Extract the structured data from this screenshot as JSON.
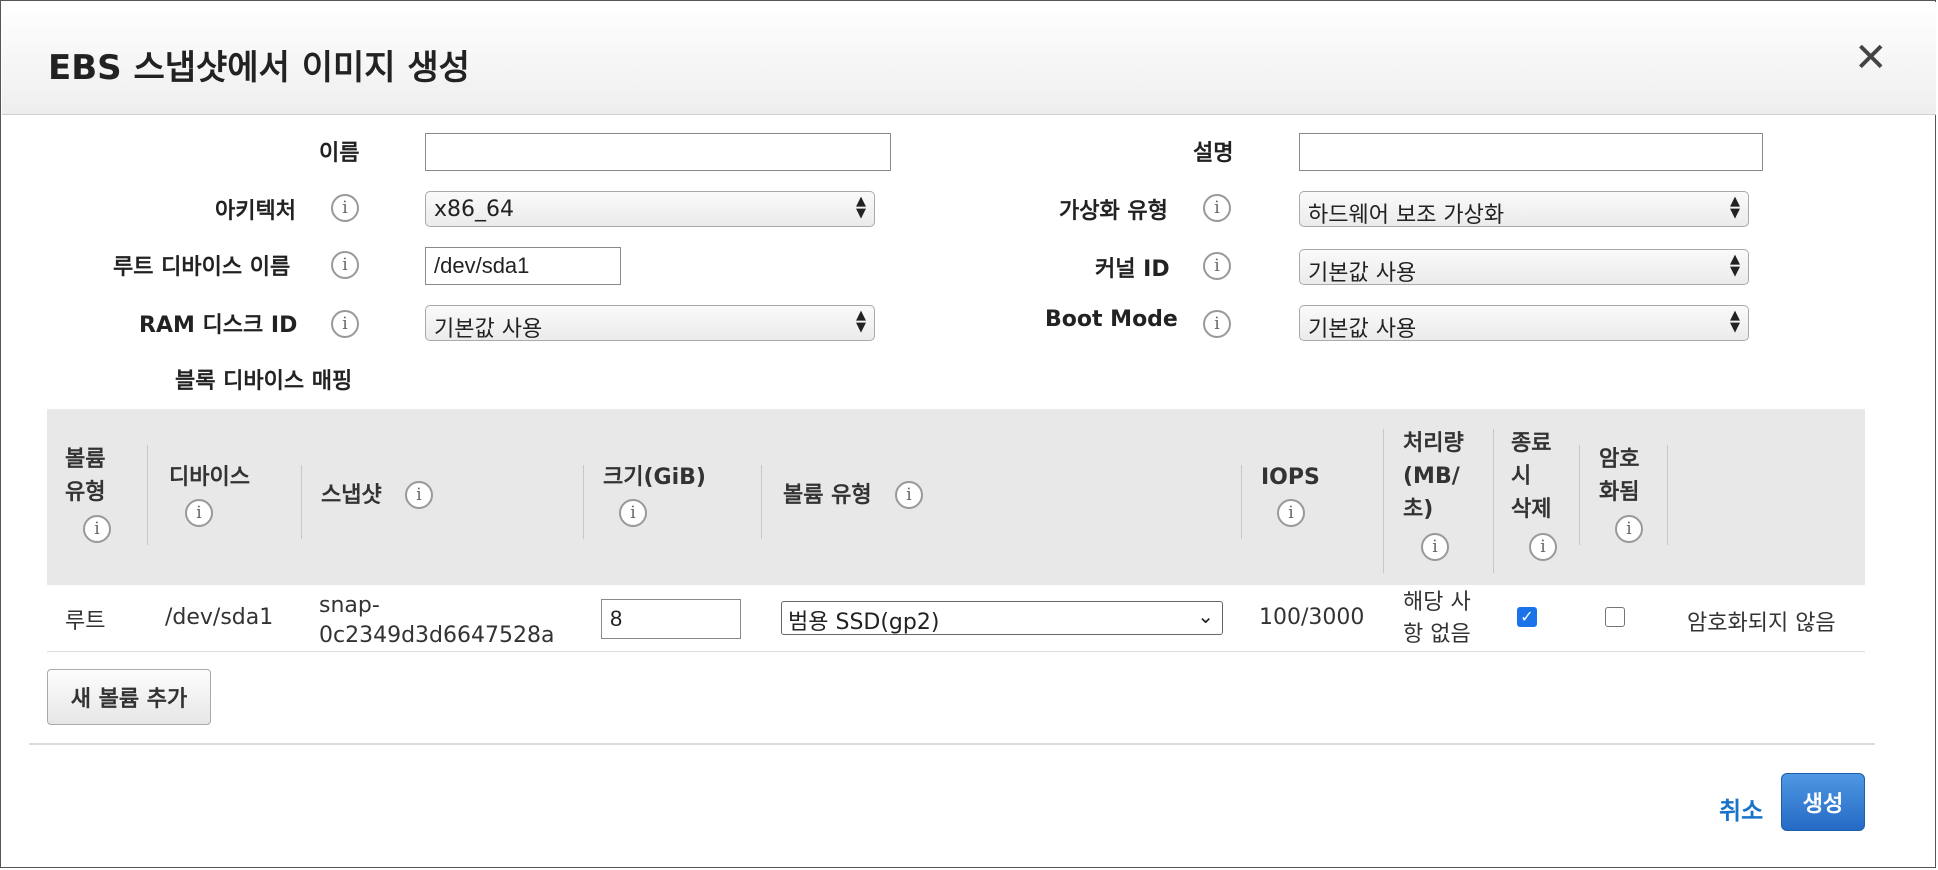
{
  "dialog": {
    "title": "EBS 스냅샷에서 이미지 생성",
    "close_icon": "close-icon"
  },
  "form": {
    "name_label": "이름",
    "name_value": "",
    "description_label": "설명",
    "description_value": "",
    "architecture_label": "아키텍처",
    "architecture_value": "x86_64",
    "virtualization_label": "가상화 유형",
    "virtualization_value": "하드웨어 보조 가상화",
    "root_device_label": "루트 디바이스 이름",
    "root_device_value": "/dev/sda1",
    "kernel_label": "커널 ID",
    "kernel_value": "기본값 사용",
    "ramdisk_label": "RAM 디스크 ID",
    "ramdisk_value": "기본값 사용",
    "boot_mode_label": "Boot Mode",
    "boot_mode_value": "기본값 사용",
    "block_mapping_label": "블록 디바이스 매핑",
    "info_icon": "i"
  },
  "table": {
    "headers": {
      "volume_type": [
        "볼륨",
        "유형"
      ],
      "device": "디바이스",
      "snapshot": "스냅샷",
      "size": "크기(GiB)",
      "vol_type": "볼륨 유형",
      "iops": "IOPS",
      "throughput": [
        "처리량",
        "(MB/",
        "초)"
      ],
      "delete_on_term": [
        "종료",
        "시",
        "삭제"
      ],
      "encrypted": [
        "암호",
        "화됨"
      ]
    },
    "row": {
      "volume_type": "루트",
      "device": "/dev/sda1",
      "snapshot_line1": "snap-",
      "snapshot_line2": "0c2349d3d6647528a",
      "size": "8",
      "vol_type": "범용 SSD(gp2)",
      "iops": "100/3000",
      "throughput_line1": "해당 사",
      "throughput_line2": "항 없음",
      "delete_on_term_checked": true,
      "encrypted_checked": false,
      "encryption_status": "암호화되지 않음"
    }
  },
  "actions": {
    "add_volume": "새 볼륨 추가",
    "cancel": "취소",
    "create": "생성"
  }
}
